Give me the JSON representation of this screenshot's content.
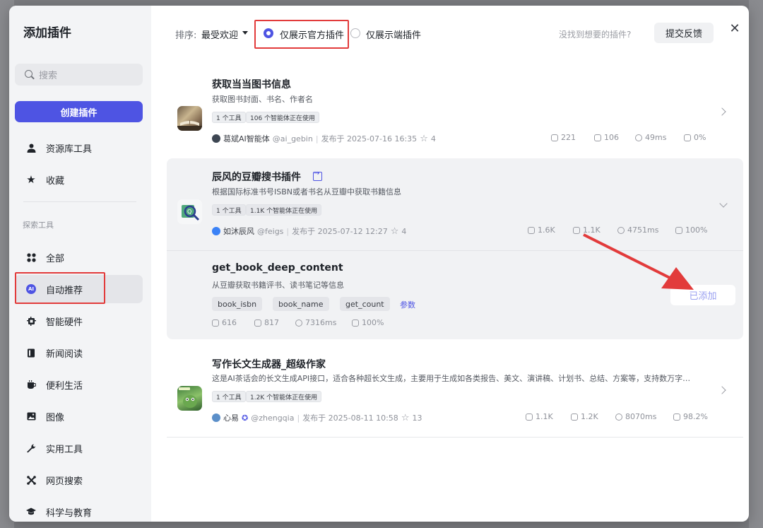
{
  "sidebar": {
    "title": "添加插件",
    "search_placeholder": "搜索",
    "create_button": "创建插件",
    "items_top": [
      {
        "label": "资源库工具",
        "icon": "person-icon"
      },
      {
        "label": "收藏",
        "icon": "star-icon"
      }
    ],
    "section_label": "探索工具",
    "categories": [
      {
        "label": "全部",
        "icon": "grid-icon"
      },
      {
        "label": "自动推荐",
        "icon": "ai-icon",
        "active": true
      },
      {
        "label": "智能硬件",
        "icon": "chip-icon"
      },
      {
        "label": "新闻阅读",
        "icon": "book-icon"
      },
      {
        "label": "便利生活",
        "icon": "cup-icon"
      },
      {
        "label": "图像",
        "icon": "image-icon"
      },
      {
        "label": "实用工具",
        "icon": "wrench-icon"
      },
      {
        "label": "网页搜索",
        "icon": "cross-icon"
      },
      {
        "label": "科学与教育",
        "icon": "graduation-cap-icon"
      }
    ]
  },
  "header": {
    "sort_label": "排序:",
    "sort_value": "最受欢迎",
    "radio_official": "仅展示官方插件",
    "radio_official_selected": true,
    "radio_client": "仅展示端插件",
    "radio_client_selected": false,
    "no_find_text": "没找到想要的插件?",
    "feedback_button": "提交反馈",
    "close": "✕"
  },
  "plugins": [
    {
      "title": "获取当当图书信息",
      "desc": "获取图书封面、书名、作者名",
      "tags": [
        "1 个工具",
        "106 个智能体正在使用"
      ],
      "author": "葛斌AI智能体",
      "handle": "@ai_gebin",
      "published": "发布于 2025-07-16 16:35",
      "stars": "4",
      "stats": [
        "221",
        "106",
        "49ms",
        "0%"
      ]
    },
    {
      "title": "辰风的豆瓣搜书插件",
      "desc": "根据国际标准书号ISBN或者书名从豆瓣中获取书籍信息",
      "tags": [
        "1 个工具",
        "1.1K 个智能体正在使用"
      ],
      "author": "如沐辰风",
      "handle": "@feigs",
      "published": "发布于 2025-07-12 12:27",
      "stars": "4",
      "stats": [
        "1.6K",
        "1.1K",
        "4751ms",
        "100%"
      ],
      "tool": {
        "name": "get_book_deep_content",
        "desc": "从豆瓣获取书籍评书、读书笔记等信息",
        "params": [
          "book_isbn",
          "book_name",
          "get_count"
        ],
        "params_link": "参数",
        "stats": [
          "616",
          "817",
          "7316ms",
          "100%"
        ],
        "added_button": "已添加"
      }
    },
    {
      "title": "写作长文生成器_超级作家",
      "desc": "这是AI茶话会的长文生成API接口，适合各种超长文生成，主要用于生成如各类报告、美文、演讲稿、计划书、总结、方案等，支持数万字…",
      "tags": [
        "1 个工具",
        "1.2K 个智能体正在使用"
      ],
      "author": "心易",
      "handle": "@zhengqia",
      "published": "发布于 2025-08-11 10:58",
      "stars": "13",
      "stats": [
        "1.1K",
        "1.2K",
        "8070ms",
        "98.2%"
      ]
    }
  ],
  "colors": {
    "accent": "#4e54e3",
    "annotation_red": "#e23b3b"
  }
}
